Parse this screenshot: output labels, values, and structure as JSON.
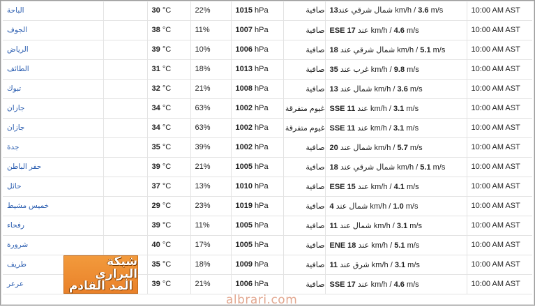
{
  "unit_temp": "°C",
  "unit_press": "hPa",
  "rows": [
    {
      "city": "الباحة",
      "temp": "30",
      "humidity": "22%",
      "pressure": "1015",
      "condition": "صافية",
      "wind_before": "13",
      "wind_text": "شمال شرقي عند km/h / ",
      "wind_ms": "3.6",
      "wind_unit": " m/s",
      "time": "10:00 AM AST"
    },
    {
      "city": "الجوف",
      "temp": "38",
      "humidity": "11%",
      "pressure": "1007",
      "condition": "صافية",
      "wind_before": "ESE 17",
      "wind_text": " عند km/h / ",
      "wind_ms": "4.6",
      "wind_unit": " m/s",
      "time": "10:00 AM AST"
    },
    {
      "city": "الرياض",
      "temp": "39",
      "humidity": "10%",
      "pressure": "1006",
      "condition": "صافية",
      "wind_before": "18",
      "wind_text": " شمال شرقي عند km/h / ",
      "wind_ms": "5.1",
      "wind_unit": " m/s",
      "time": "10:00 AM AST"
    },
    {
      "city": "الطائف",
      "temp": "31",
      "humidity": "18%",
      "pressure": "1013",
      "condition": "صافية",
      "wind_before": "35",
      "wind_text": " غرب عند km/h / ",
      "wind_ms": "9.8",
      "wind_unit": " m/s",
      "time": "10:00 AM AST"
    },
    {
      "city": "تبوك",
      "temp": "32",
      "humidity": "21%",
      "pressure": "1008",
      "condition": "صافية",
      "wind_before": "13",
      "wind_text": " شمال عند km/h / ",
      "wind_ms": "3.6",
      "wind_unit": " m/s",
      "time": "10:00 AM AST"
    },
    {
      "city": "جازان",
      "temp": "34",
      "humidity": "63%",
      "pressure": "1002",
      "condition": "غيوم متفرقة",
      "wind_before": "SSE 11",
      "wind_text": " عند km/h / ",
      "wind_ms": "3.1",
      "wind_unit": " m/s",
      "time": "10:00 AM AST"
    },
    {
      "city": "جازان",
      "temp": "34",
      "humidity": "63%",
      "pressure": "1002",
      "condition": "غيوم متفرقة",
      "wind_before": "SSE 11",
      "wind_text": " عند km/h / ",
      "wind_ms": "3.1",
      "wind_unit": " m/s",
      "time": "10:00 AM AST"
    },
    {
      "city": "جدة",
      "temp": "35",
      "humidity": "39%",
      "pressure": "1002",
      "condition": "صافية",
      "wind_before": "20",
      "wind_text": " شمال عند km/h / ",
      "wind_ms": "5.7",
      "wind_unit": " m/s",
      "time": "10:00 AM AST"
    },
    {
      "city": "حفر الباطن",
      "temp": "39",
      "humidity": "21%",
      "pressure": "1005",
      "condition": "صافية",
      "wind_before": "18",
      "wind_text": " شمال شرقي عند km/h / ",
      "wind_ms": "5.1",
      "wind_unit": " m/s",
      "time": "10:00 AM AST"
    },
    {
      "city": "حائل",
      "temp": "37",
      "humidity": "13%",
      "pressure": "1010",
      "condition": "صافية",
      "wind_before": "ESE 15",
      "wind_text": " عند km/h / ",
      "wind_ms": "4.1",
      "wind_unit": " m/s",
      "time": "10:00 AM AST"
    },
    {
      "city": "خميس مشيط",
      "temp": "29",
      "humidity": "23%",
      "pressure": "1019",
      "condition": "صافية",
      "wind_before": "4",
      "wind_text": " شمال عند km/h / ",
      "wind_ms": "1.0",
      "wind_unit": " m/s",
      "time": "10:00 AM AST"
    },
    {
      "city": "رفحاء",
      "temp": "39",
      "humidity": "11%",
      "pressure": "1005",
      "condition": "صافية",
      "wind_before": "11",
      "wind_text": " شمال عند km/h / ",
      "wind_ms": "3.1",
      "wind_unit": " m/s",
      "time": "10:00 AM AST"
    },
    {
      "city": "شرورة",
      "temp": "40",
      "humidity": "17%",
      "pressure": "1005",
      "condition": "صافية",
      "wind_before": "ENE 18",
      "wind_text": " عند km/h / ",
      "wind_ms": "5.1",
      "wind_unit": " m/s",
      "time": "10:00 AM AST"
    },
    {
      "city": "طريف",
      "temp": "35",
      "humidity": "18%",
      "pressure": "1009",
      "condition": "صافية",
      "wind_before": "11",
      "wind_text": " شرق عند km/h / ",
      "wind_ms": "3.1",
      "wind_unit": " m/s",
      "time": "10:00 AM AST"
    },
    {
      "city": "عرعر",
      "temp": "39",
      "humidity": "21%",
      "pressure": "1006",
      "condition": "صافية",
      "wind_before": "SSE 17",
      "wind_text": " عند km/h / ",
      "wind_ms": "4.6",
      "wind_unit": " m/s",
      "time": "10:00 AM AST"
    }
  ],
  "stamp": {
    "line1": "شبكة البراري",
    "line2": "المد القادم"
  },
  "watermark": "albrari.com"
}
